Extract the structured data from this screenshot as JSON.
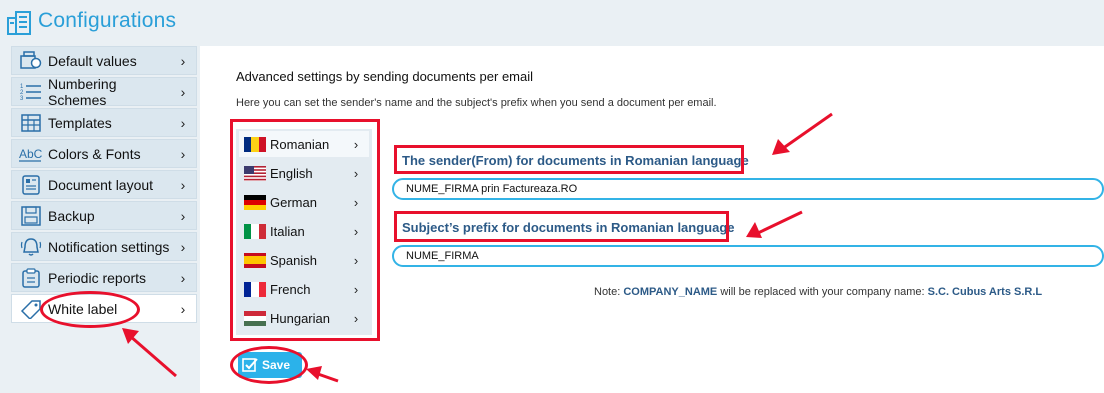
{
  "header": {
    "title": "Configurations",
    "icon": "building-icon"
  },
  "sidebar": {
    "items": [
      {
        "label": "Default values",
        "icon": "defaults-icon"
      },
      {
        "label": "Numbering Schemes",
        "icon": "numbered-list-icon"
      },
      {
        "label": "Templates",
        "icon": "table-icon"
      },
      {
        "label": "Colors & Fonts",
        "icon": "abc-icon"
      },
      {
        "label": "Document layout",
        "icon": "layout-icon"
      },
      {
        "label": "Backup",
        "icon": "backup-icon"
      },
      {
        "label": "Notification settings",
        "icon": "bell-icon"
      },
      {
        "label": "Periodic reports",
        "icon": "clipboard-icon"
      },
      {
        "label": "White label",
        "icon": "tag-icon",
        "active": true
      }
    ],
    "chevron": "›"
  },
  "main": {
    "title": "Advanced settings by sending documents per email",
    "description": "Here you can set the sender's name and the subject's prefix when you send a document per email."
  },
  "languages": [
    {
      "label": "Romanian",
      "flag": "ro",
      "selected": true
    },
    {
      "label": "English",
      "flag": "us"
    },
    {
      "label": "German",
      "flag": "de"
    },
    {
      "label": "Italian",
      "flag": "it"
    },
    {
      "label": "Spanish",
      "flag": "es"
    },
    {
      "label": "French",
      "flag": "fr"
    },
    {
      "label": "Hungarian",
      "flag": "hu"
    }
  ],
  "form": {
    "sender_label": "The sender(From) for documents in Romanian language",
    "sender_value": "NUME_FIRMA prin Factureaza.RO",
    "subject_label": "Subject’s prefix for documents in Romanian language",
    "subject_value": "NUME_FIRMA"
  },
  "note": {
    "prefix": "Note: ",
    "placeholder": "COMPANY_NAME",
    "middle": " will be replaced with your company name: ",
    "company": "S.C. Cubus Arts S.R.L"
  },
  "save": {
    "label": "Save"
  },
  "colors": {
    "accent": "#2bb2ea",
    "title_blue": "#2a9fd8",
    "label_blue": "#2c5a87",
    "annotation_red": "#e8102c",
    "sidebar_bg": "#eaf0f4"
  }
}
